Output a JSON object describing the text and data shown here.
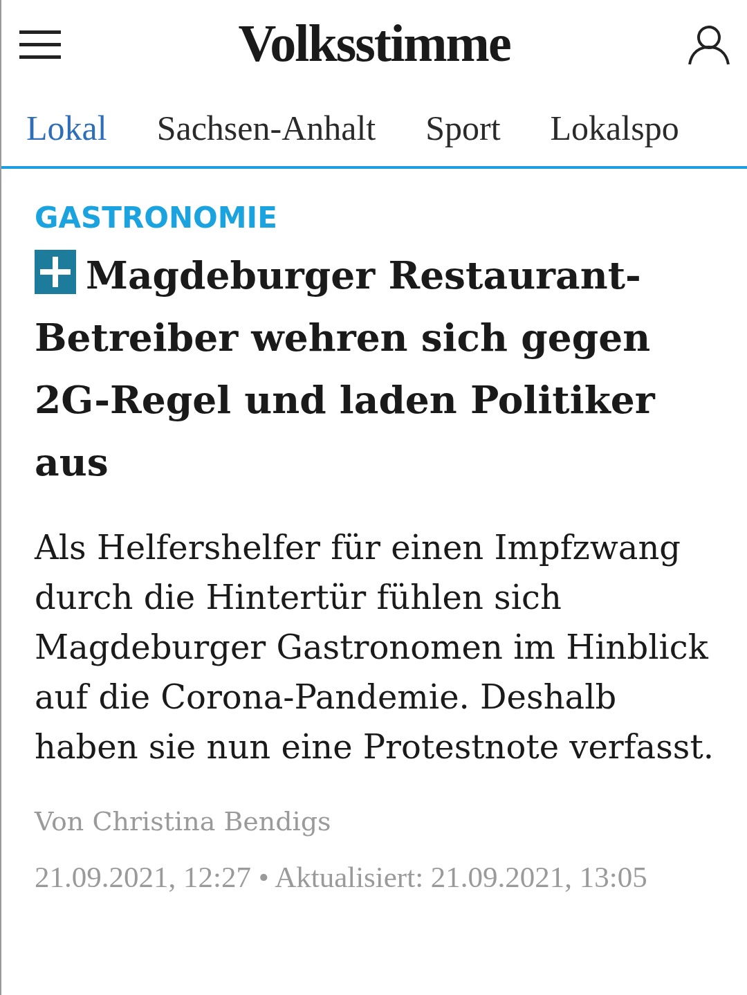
{
  "header": {
    "logo": "Volksstimme"
  },
  "tabs": [
    {
      "label": "Lokal",
      "selected": true
    },
    {
      "label": "Sachsen-Anhalt",
      "selected": false
    },
    {
      "label": "Sport",
      "selected": false
    },
    {
      "label": "Lokalspo",
      "selected": false
    }
  ],
  "article": {
    "category": "GASTRONOMIE",
    "premium": true,
    "headline": "Magdeburger Restaurant-Betreiber wehren sich gegen 2G-Regel und laden Politiker aus",
    "lead": "Als Helfershelfer für einen Impfzwang durch die Hintertür fühlen sich Magdeburger Gastronomen im Hinblick auf die Corona-Pandemie. Deshalb haben sie nun eine Protestnote verfasst.",
    "byline": "Von Christina Bendigs",
    "date": "21.09.2021, 12:27 • Aktualisiert: 21.09.2021, 13:05"
  }
}
